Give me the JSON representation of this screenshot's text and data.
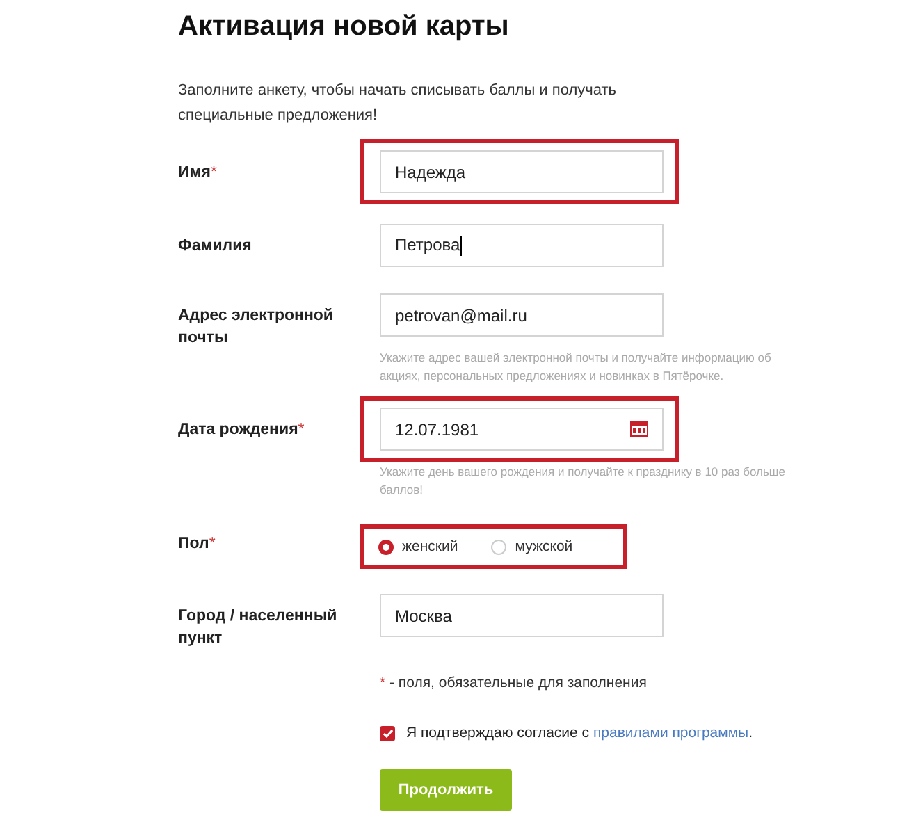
{
  "title": "Активация новой карты",
  "intro": "Заполните анкету, чтобы начать списывать баллы и получать специальные предложения!",
  "fields": [
    {
      "kind": "text",
      "label": "Имя",
      "required_mark": "*",
      "value": "Надежда",
      "highlighted": true
    },
    {
      "kind": "text",
      "label": "Фамилия",
      "value": "Петрова",
      "highlighted": false,
      "focused": true
    },
    {
      "kind": "text",
      "label": "Адрес электронной почты",
      "value": "petrovan@mail.ru",
      "hint": "Укажите адрес вашей электронной почты и получайте информацию об акциях, персональных предложениях и новинках в Пятёрочке.",
      "highlighted": false
    },
    {
      "kind": "date",
      "label": "Дата рождения",
      "required_mark": "*",
      "value": "12.07.1981",
      "hint": "Укажите день вашего рождения и получайте к празднику в 10 раз больше баллов!",
      "highlighted": true
    },
    {
      "kind": "radio",
      "label": "Пол",
      "required_mark": "*",
      "highlighted": true,
      "options": [
        {
          "label": "женский",
          "selected": true
        },
        {
          "label": "мужской",
          "selected": false
        }
      ]
    },
    {
      "kind": "text",
      "label": "Город / населенный пункт",
      "value": "Москва",
      "highlighted": false
    }
  ],
  "required_note": {
    "mark": "*",
    "text": " - поля, обязательные для заполнения"
  },
  "consent": {
    "checked": true,
    "text": "Я подтверждаю согласие с ",
    "link": "правилами программы",
    "end": "."
  },
  "submit": "Продолжить"
}
